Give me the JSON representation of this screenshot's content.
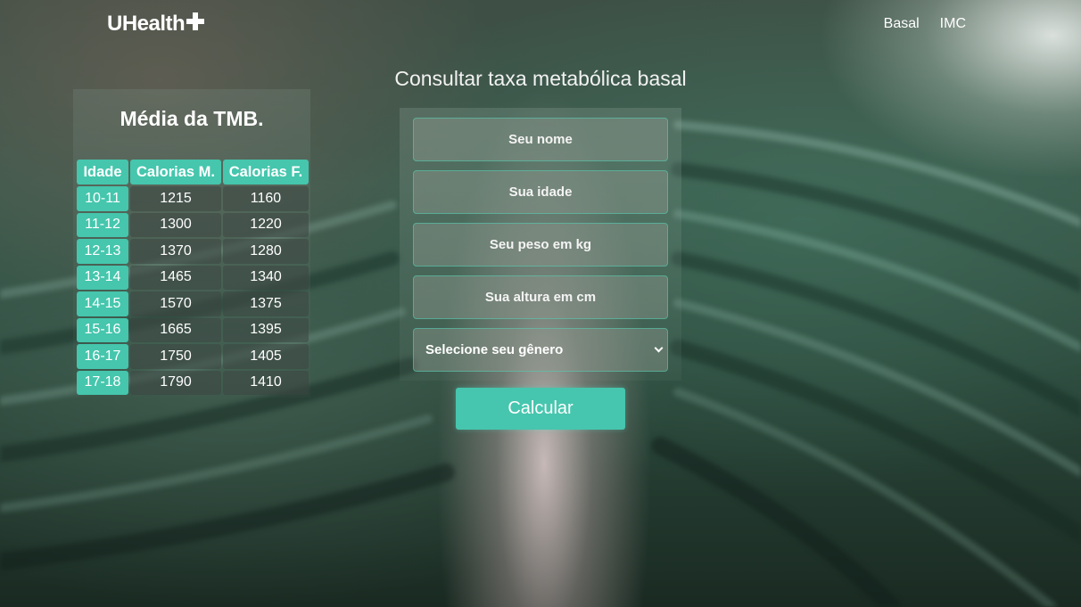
{
  "header": {
    "logo": "UHealth",
    "nav": [
      {
        "label": "Basal"
      },
      {
        "label": "IMC"
      }
    ]
  },
  "page_title": "Consultar taxa metabólica basal",
  "tmb_table": {
    "title": "Média da TMB.",
    "headers": [
      "Idade",
      "Calorias M.",
      "Calorias F."
    ],
    "rows": [
      [
        "10-11",
        "1215",
        "1160"
      ],
      [
        "11-12",
        "1300",
        "1220"
      ],
      [
        "12-13",
        "1370",
        "1280"
      ],
      [
        "13-14",
        "1465",
        "1340"
      ],
      [
        "14-15",
        "1570",
        "1375"
      ],
      [
        "15-16",
        "1665",
        "1395"
      ],
      [
        "16-17",
        "1750",
        "1405"
      ],
      [
        "17-18",
        "1790",
        "1410"
      ]
    ]
  },
  "form": {
    "name_placeholder": "Seu nome",
    "age_placeholder": "Sua idade",
    "weight_placeholder": "Seu peso em kg",
    "height_placeholder": "Sua altura em cm",
    "gender_selected": "Selecione seu gênero",
    "submit_label": "Calcular"
  },
  "colors": {
    "accent": "#45c6ad"
  }
}
